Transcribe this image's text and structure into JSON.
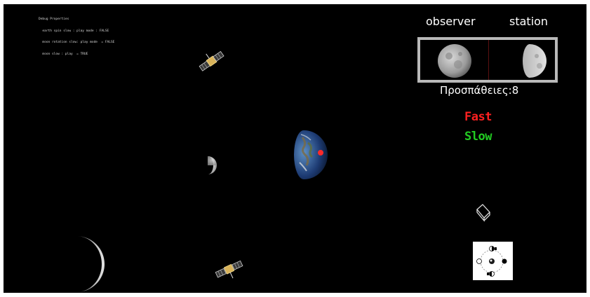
{
  "debug": {
    "lines": [
      "Debug Properties",
      "  earth spin slow : play mode : FALSE",
      "  moon rotation slow: play mode  = FALSE",
      "  moon slow : play  = TRUE"
    ]
  },
  "header": {
    "observer_label": "observer",
    "station_label": "station"
  },
  "attempts": {
    "label": "Προσπάθειες:8"
  },
  "speed_controls": {
    "fast_label": "Fast",
    "slow_label": "Slow"
  },
  "colors": {
    "background": "#000000",
    "fast": "#ff2020",
    "slow": "#22cc22",
    "frame": "#b9b9b9",
    "earth_marker": "#ff2a2a"
  },
  "icons": {
    "satellite": "satellite-icon",
    "moon": "moon-icon",
    "earth": "earth-icon",
    "camera": "camera-icon",
    "orbit_panel": "orbit-diagram-icon"
  }
}
